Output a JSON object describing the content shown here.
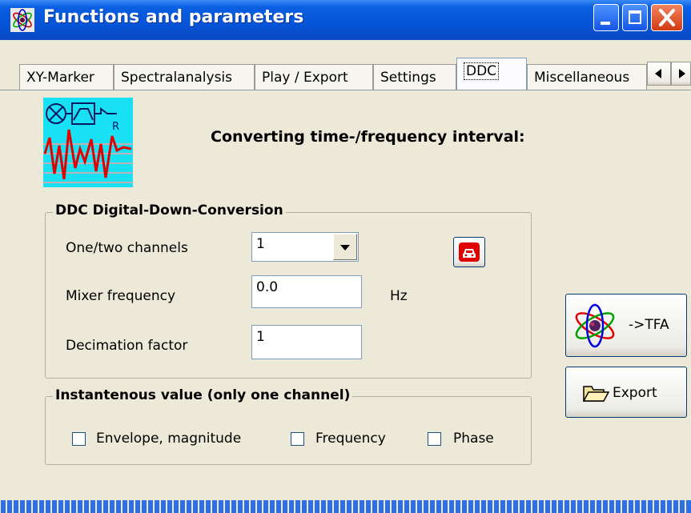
{
  "window": {
    "title": "Functions and parameters"
  },
  "tabs": [
    {
      "label": "XY-Marker"
    },
    {
      "label": "Spectralanalysis"
    },
    {
      "label": "Play / Export"
    },
    {
      "label": "Settings"
    },
    {
      "label": "DDC"
    },
    {
      "label": "Miscellaneous"
    }
  ],
  "main": {
    "heading": "Converting time-/frequency interval:"
  },
  "ddc_group": {
    "title": "DDC Digital-Down-Conversion",
    "channels_label": "One/two channels",
    "channels_value": "1",
    "mixer_label": "Mixer frequency",
    "mixer_value": "0.0",
    "mixer_unit": "Hz",
    "decimation_label": "Decimation factor",
    "decimation_value": "1"
  },
  "instant_group": {
    "title": "Instantenous value (only one channel)",
    "checkbox_envelope": "Envelope, magnitude",
    "checkbox_frequency": "Frequency",
    "checkbox_phase": "Phase"
  },
  "buttons": {
    "tfa_label": "->TFA",
    "export_label": "Export"
  },
  "colors": {
    "titlebar": "#0654d8",
    "panel": "#ece9d8",
    "close": "#d23b12"
  }
}
